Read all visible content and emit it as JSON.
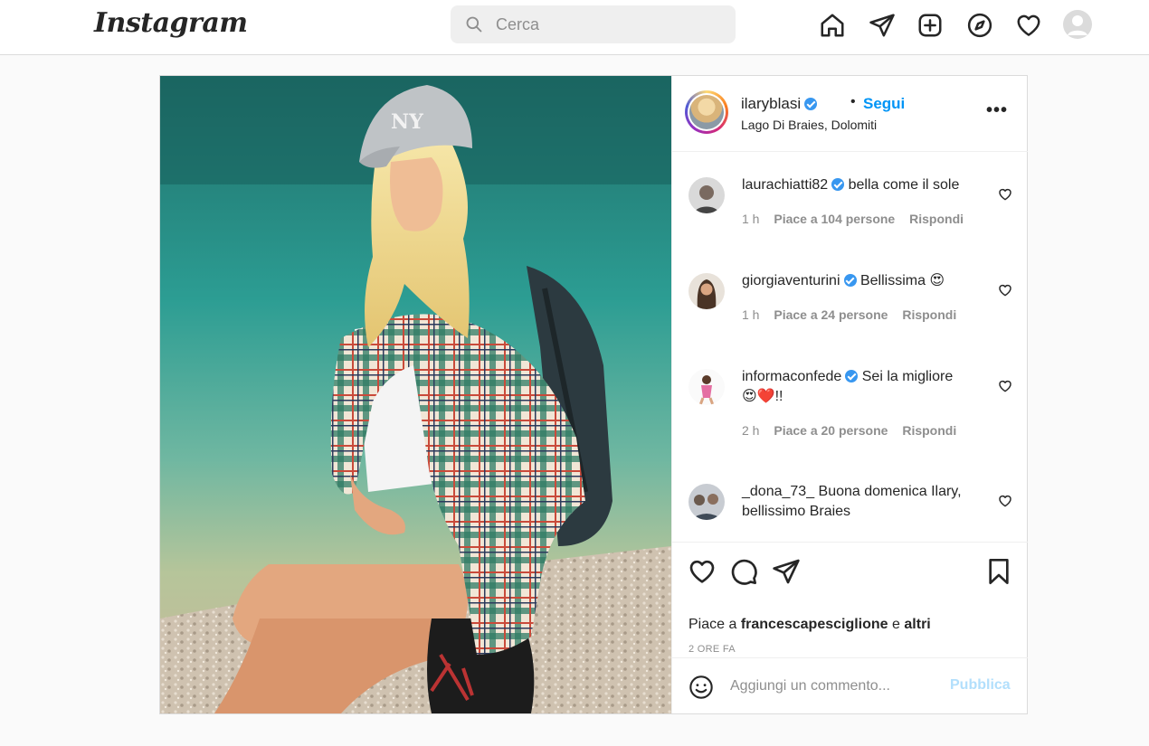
{
  "app": {
    "logo_text": "Instagram"
  },
  "search": {
    "placeholder": "Cerca"
  },
  "nav": {
    "icons": [
      "home-icon",
      "direct-icon",
      "new-post-icon",
      "explore-icon",
      "activity-icon",
      "profile-avatar"
    ]
  },
  "post": {
    "author": "ilaryblasi",
    "follow_label": "Segui",
    "separator": "•",
    "location": "Lago Di Braies, Dolomiti",
    "more_label": "•••",
    "comments": [
      {
        "user": "laurachiatti82",
        "verified": true,
        "text": "bella come il sole",
        "time": "1 h",
        "likes": "Piace a 104 persone",
        "reply": "Rispondi"
      },
      {
        "user": "giorgiaventurini",
        "verified": true,
        "text": "Bellissima 😍",
        "time": "1 h",
        "likes": "Piace a 24 persone",
        "reply": "Rispondi"
      },
      {
        "user": "informaconfede",
        "verified": true,
        "text": "Sei la migliore",
        "text2": "😍❤️!!",
        "time": "2 h",
        "likes": "Piace a 20 persone",
        "reply": "Rispondi"
      },
      {
        "user": "_dona_73_",
        "verified": false,
        "text": "Buona domenica Ilary, bellissimo Braies"
      }
    ],
    "likes_prefix": "Piace a",
    "likes_user": "francescapesciglione",
    "likes_conj": "e",
    "likes_others": "altri",
    "timestamp": "2 ORE FA",
    "add_comment_placeholder": "Aggiungi un commento...",
    "publish_label": "Pubblica"
  },
  "colors": {
    "accent": "#0095f6",
    "publish_disabled": "#b2dffc",
    "verified": "#3897f0"
  }
}
